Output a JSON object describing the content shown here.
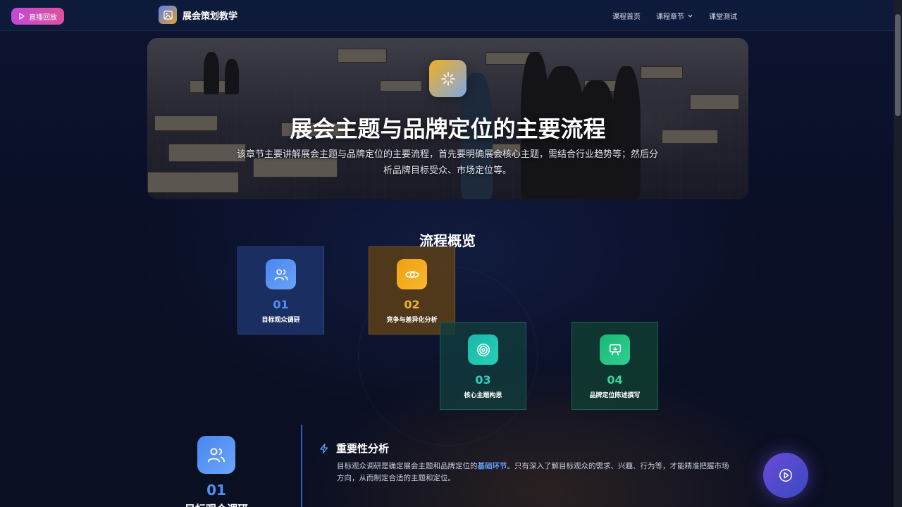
{
  "topbar": {
    "live_button_label": "直播回放",
    "brand_title": "展会策划教学",
    "nav": [
      {
        "label": "课程首页"
      },
      {
        "label": "课程章节"
      },
      {
        "label": "课堂测试"
      }
    ]
  },
  "hero": {
    "icon": "sparkle-icon",
    "title": "展会主题与品牌定位的主要流程",
    "description": "该章节主要讲解展会主题与品牌定位的主要流程，首先要明确展会核心主题，需结合行业趋势等；然后分析品牌目标受众、市场定位等。"
  },
  "overview": {
    "title": "流程概览",
    "steps": [
      {
        "num": "01",
        "label": "目标观众调研",
        "icon": "users-icon",
        "color": "#4f92f5"
      },
      {
        "num": "02",
        "label": "竞争与差异化分析",
        "icon": "eye-icon",
        "color": "#f2b030"
      },
      {
        "num": "03",
        "label": "核心主题构思",
        "icon": "target-icon",
        "color": "#30d0c0"
      },
      {
        "num": "04",
        "label": "品牌定位陈述撰写",
        "icon": "presentation-icon",
        "color": "#36d898"
      }
    ]
  },
  "detail": {
    "num": "01",
    "label": "目标观众调研",
    "section_title": "重要性分析",
    "text_before": "目标观众调研是确定展会主题和品牌定位的",
    "text_highlight": "基础环节",
    "text_after": "。只有深入了解目标观众的需求、兴趣、行为等，才能精准把握市场方向，从而制定合适的主题和定位。"
  }
}
